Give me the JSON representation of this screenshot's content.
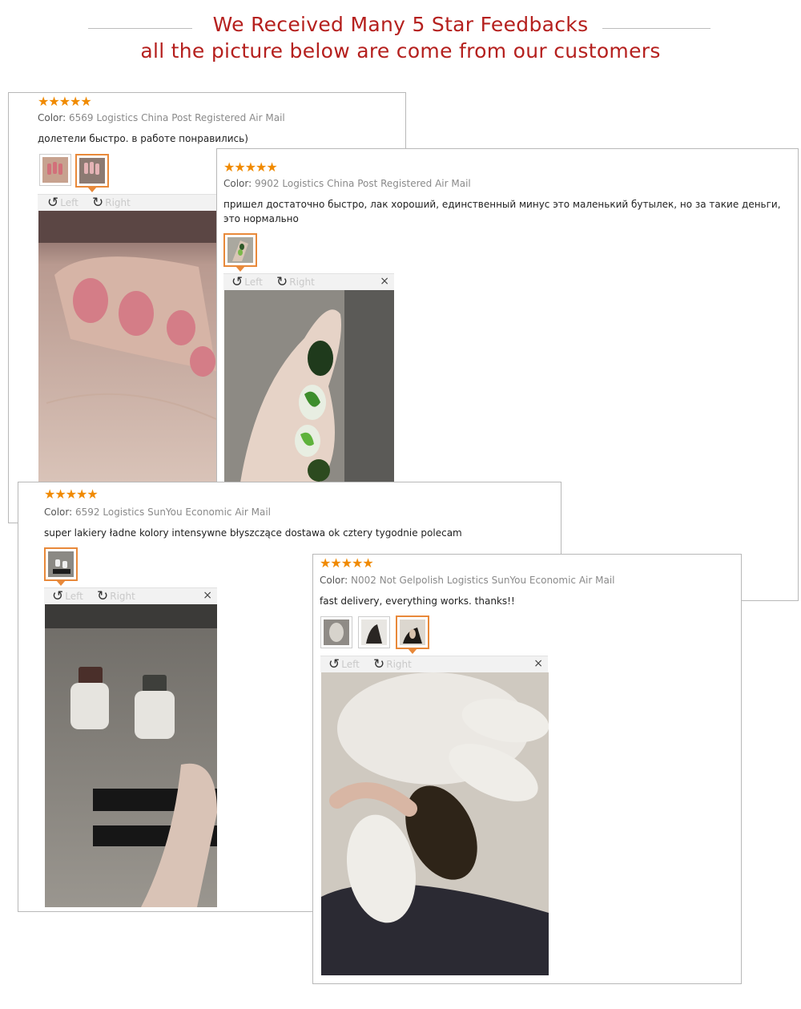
{
  "header": {
    "title": "We Received Many 5 Star Feedbacks",
    "subtitle": "all the picture below are come from our customers"
  },
  "common": {
    "stars": "★★★★★",
    "color_label": "Color:",
    "left_label": "Left",
    "right_label": "Right",
    "close_glyph": "×",
    "rotate_left_glyph": "↺",
    "rotate_right_glyph": "↻"
  },
  "reviews": [
    {
      "rating": 5,
      "color_value": "6569",
      "logistics": "Logistics China Post Registered Air Mail",
      "text": "долетели быстро. в работе понравились)",
      "thumb_count": 2,
      "active_thumb": 2
    },
    {
      "rating": 5,
      "color_value": "9902",
      "logistics": "Logistics China Post Registered Air Mail",
      "text": "пришел достаточно быстро, лак хороший, единственный минус это маленький бутылек, но за такие деньги, это нормально",
      "thumb_count": 1,
      "active_thumb": 1
    },
    {
      "rating": 5,
      "color_value": "6592",
      "logistics": "Logistics SunYou Economic Air Mail",
      "text": "super lakiery ładne kolory intensywne błyszczące dostawa ok cztery tygodnie polecam",
      "thumb_count": 1,
      "active_thumb": 1
    },
    {
      "rating": 5,
      "color_value": "N002 Not Gelpolish",
      "logistics": "Logistics SunYou Economic Air Mail",
      "text": "fast delivery, everything works. thanks!!",
      "thumb_count": 3,
      "active_thumb": 3
    }
  ],
  "colors": {
    "headline": "#b5201e",
    "stars": "#f08a00",
    "active_thumb_border": "#e8893a"
  }
}
